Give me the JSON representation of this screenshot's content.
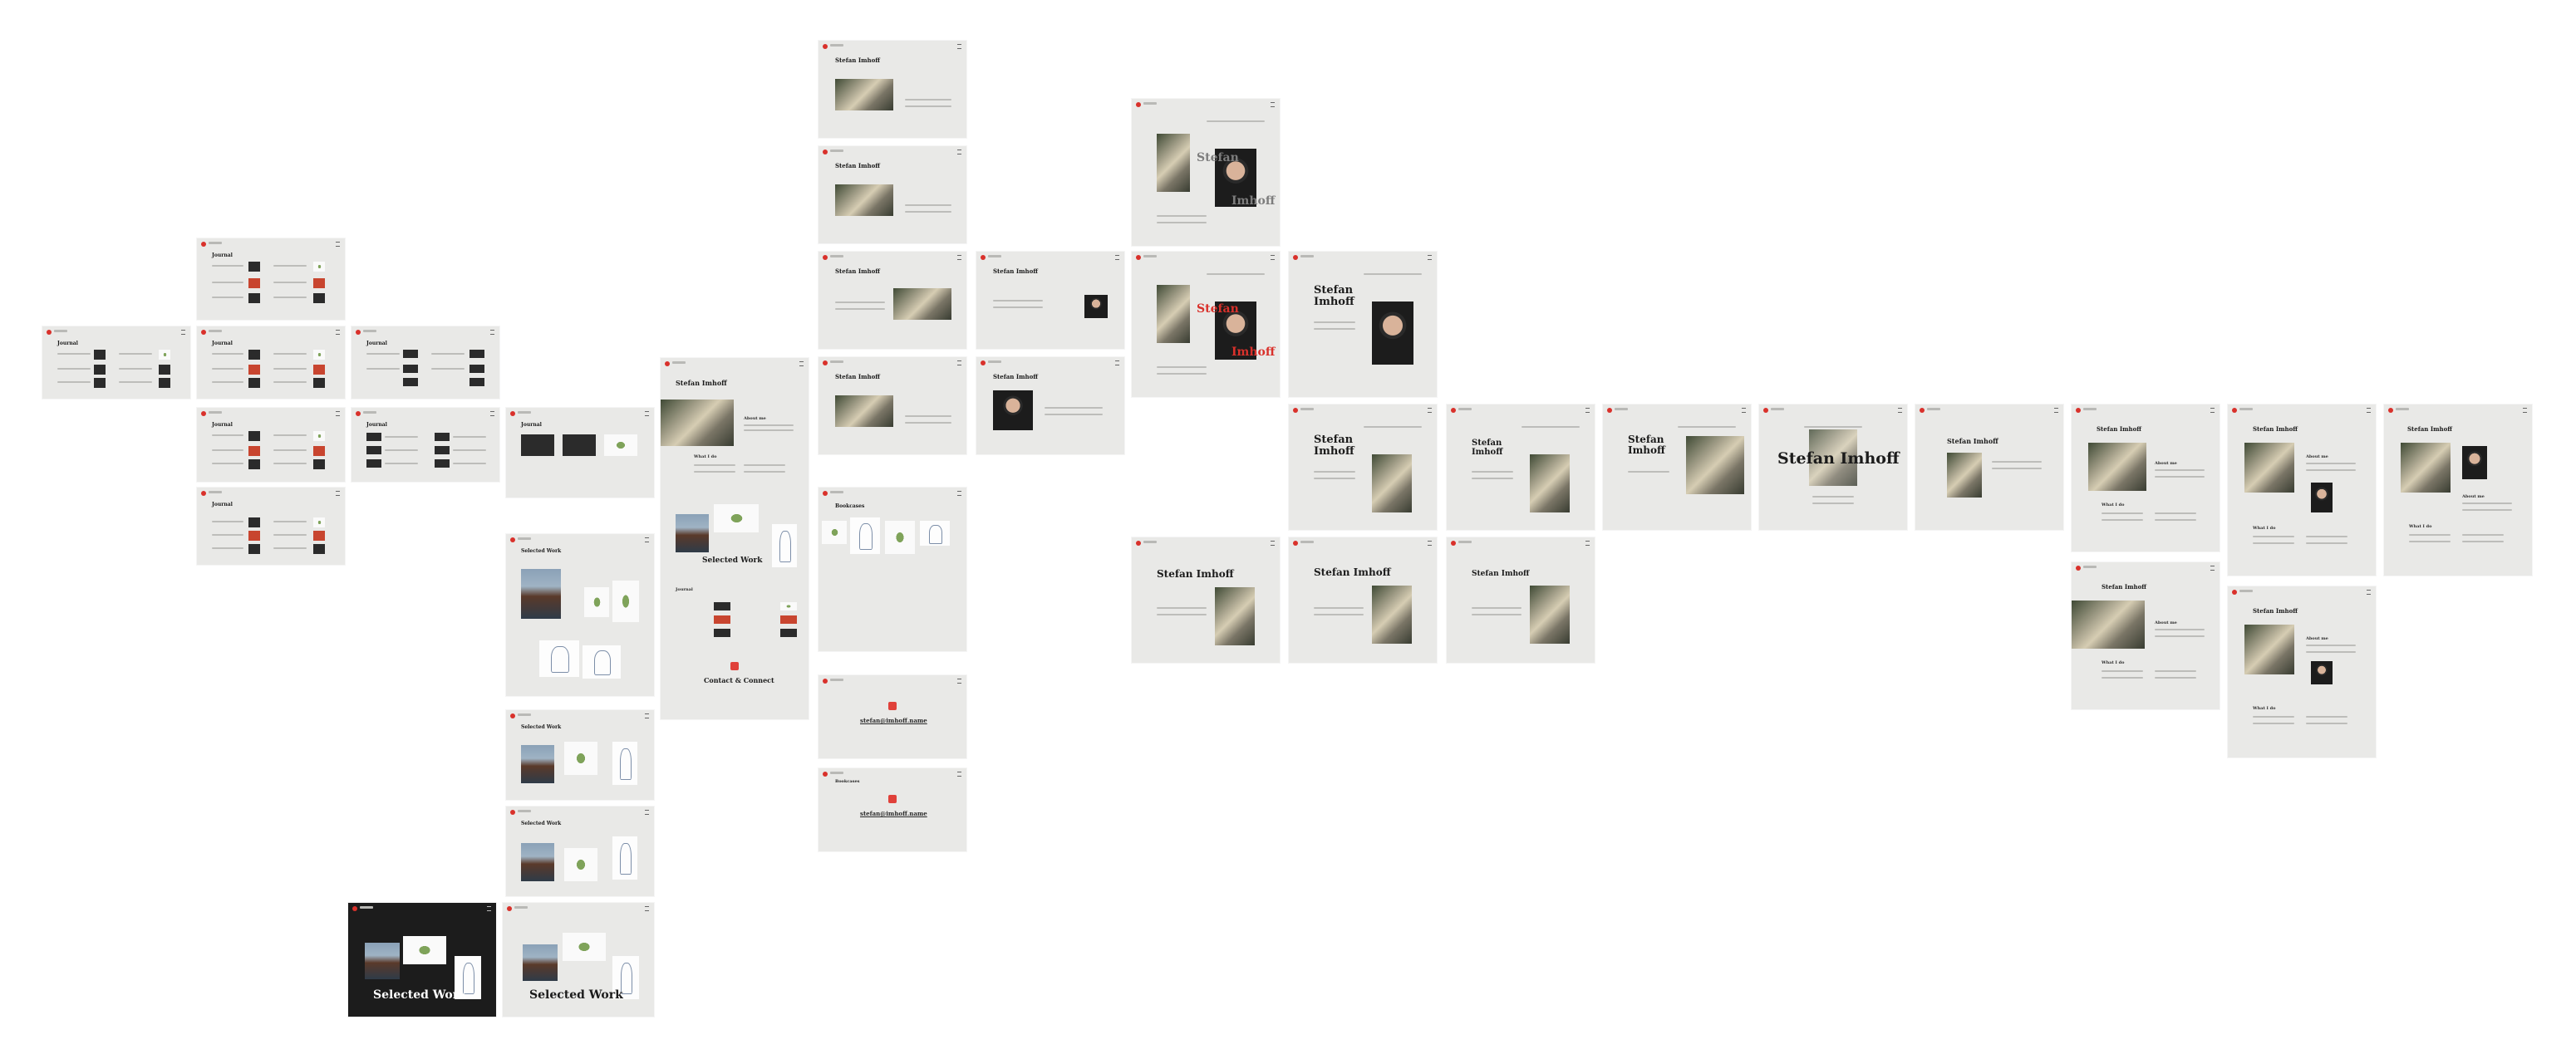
{
  "canvas": {
    "title": ""
  },
  "text": {
    "name": "Stefan Imhoff",
    "name_line1": "Stefan",
    "name_line2": "Imhoff",
    "stefan": "Stefan",
    "imhoff": "Imhoff",
    "journal": "Journal",
    "selected_work": "Selected Work",
    "about_me": "About me",
    "what_i_do": "What I do",
    "contact": "Contact & Connect",
    "email": "stefan@imhoff.name",
    "bookcases": "Bookcases"
  },
  "colors": {
    "accent": "#d9312b",
    "frame_bg": "#e9e9e7",
    "dark_bg": "#1c1c1c"
  }
}
